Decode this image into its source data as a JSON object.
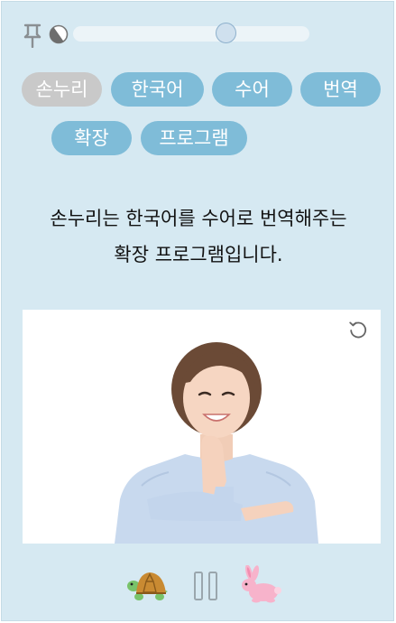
{
  "app": {
    "chips": [
      {
        "label": "손누리",
        "selected": true
      },
      {
        "label": "한국어",
        "selected": false
      },
      {
        "label": "수어",
        "selected": false
      },
      {
        "label": "번역",
        "selected": false
      },
      {
        "label": "확장",
        "selected": false
      },
      {
        "label": "프로그램",
        "selected": false
      }
    ],
    "description_lines": [
      "손누리는 한국어를 수어로 번역해주는",
      "확장 프로그램입니다."
    ],
    "opacity_slider_value": 0.65,
    "icons": {
      "pin": "pin-icon",
      "contrast": "contrast-icon",
      "replay": "replay-icon",
      "slow": "turtle-icon",
      "pause": "pause-icon",
      "fast": "rabbit-icon"
    },
    "colors": {
      "background": "#d6e9f2",
      "chip": "#7fbcd8",
      "chip_selected": "#c9c9c9",
      "pause_icon": "#9aa6ad"
    }
  }
}
